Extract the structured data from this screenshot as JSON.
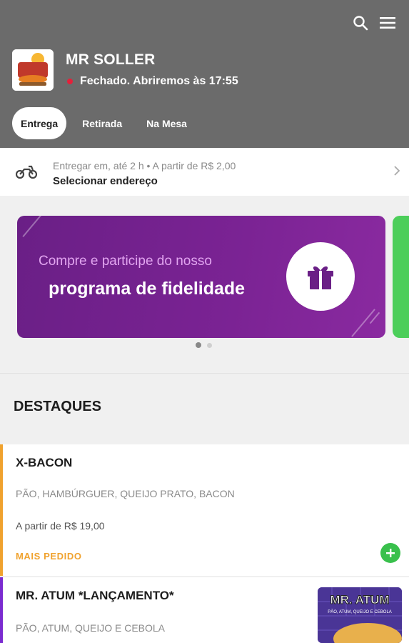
{
  "header": {
    "store_name": "MR SOLLER",
    "status": "Fechado. Abriremos às 17:55",
    "status_color": "#e5203a",
    "logo_text": "Mr. Soller",
    "icons": [
      "search-icon",
      "menu-icon"
    ],
    "tabs": [
      {
        "label": "Entrega",
        "active": true
      },
      {
        "label": "Retirada",
        "active": false
      },
      {
        "label": "Na Mesa",
        "active": false
      }
    ]
  },
  "delivery": {
    "info": "Entregar em, até 2 h  •  A partir de R$ 2,00",
    "action": "Selecionar endereço",
    "icon": "motorcycle-icon"
  },
  "banner": {
    "line1": "Compre e participe do nosso",
    "line2": "programa de fidelidade",
    "icon": "gift-icon",
    "active_slide": 1,
    "slide_count": 2
  },
  "section": {
    "title": "DESTAQUES"
  },
  "products": [
    {
      "name": "X-BACON",
      "description": "PÃO, HAMBÚRGUER, QUEIJO PRATO, BACON",
      "price": "A partir de R$ 19,00",
      "badge": "MAIS PEDIDO",
      "accent": "#f0a22e"
    },
    {
      "name": "MR. ATUM *LANÇAMENTO*",
      "description": "PÃO, ATUM, QUEIJO E CEBOLA",
      "thumb_title": "MR. ATUM",
      "thumb_sub": "PÃO, ATUM, QUEIJO E CEBOLA",
      "accent": "#7b2bd0"
    }
  ],
  "colors": {
    "header_bg": "#6b6b6b",
    "banner_purple": "#7b2394",
    "add_green": "#39c04c"
  }
}
